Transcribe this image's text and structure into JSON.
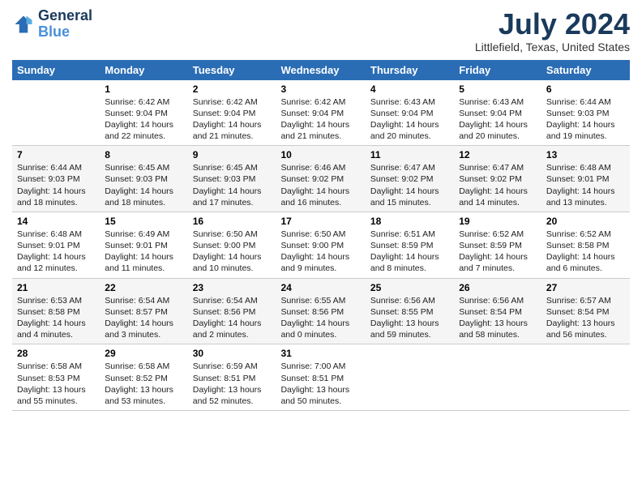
{
  "logo": {
    "line1": "General",
    "line2": "Blue"
  },
  "title": "July 2024",
  "location": "Littlefield, Texas, United States",
  "days_of_week": [
    "Sunday",
    "Monday",
    "Tuesday",
    "Wednesday",
    "Thursday",
    "Friday",
    "Saturday"
  ],
  "weeks": [
    [
      {
        "day": "",
        "info": ""
      },
      {
        "day": "1",
        "info": "Sunrise: 6:42 AM\nSunset: 9:04 PM\nDaylight: 14 hours\nand 22 minutes."
      },
      {
        "day": "2",
        "info": "Sunrise: 6:42 AM\nSunset: 9:04 PM\nDaylight: 14 hours\nand 21 minutes."
      },
      {
        "day": "3",
        "info": "Sunrise: 6:42 AM\nSunset: 9:04 PM\nDaylight: 14 hours\nand 21 minutes."
      },
      {
        "day": "4",
        "info": "Sunrise: 6:43 AM\nSunset: 9:04 PM\nDaylight: 14 hours\nand 20 minutes."
      },
      {
        "day": "5",
        "info": "Sunrise: 6:43 AM\nSunset: 9:04 PM\nDaylight: 14 hours\nand 20 minutes."
      },
      {
        "day": "6",
        "info": "Sunrise: 6:44 AM\nSunset: 9:03 PM\nDaylight: 14 hours\nand 19 minutes."
      }
    ],
    [
      {
        "day": "7",
        "info": "Sunrise: 6:44 AM\nSunset: 9:03 PM\nDaylight: 14 hours\nand 18 minutes."
      },
      {
        "day": "8",
        "info": "Sunrise: 6:45 AM\nSunset: 9:03 PM\nDaylight: 14 hours\nand 18 minutes."
      },
      {
        "day": "9",
        "info": "Sunrise: 6:45 AM\nSunset: 9:03 PM\nDaylight: 14 hours\nand 17 minutes."
      },
      {
        "day": "10",
        "info": "Sunrise: 6:46 AM\nSunset: 9:02 PM\nDaylight: 14 hours\nand 16 minutes."
      },
      {
        "day": "11",
        "info": "Sunrise: 6:47 AM\nSunset: 9:02 PM\nDaylight: 14 hours\nand 15 minutes."
      },
      {
        "day": "12",
        "info": "Sunrise: 6:47 AM\nSunset: 9:02 PM\nDaylight: 14 hours\nand 14 minutes."
      },
      {
        "day": "13",
        "info": "Sunrise: 6:48 AM\nSunset: 9:01 PM\nDaylight: 14 hours\nand 13 minutes."
      }
    ],
    [
      {
        "day": "14",
        "info": "Sunrise: 6:48 AM\nSunset: 9:01 PM\nDaylight: 14 hours\nand 12 minutes."
      },
      {
        "day": "15",
        "info": "Sunrise: 6:49 AM\nSunset: 9:01 PM\nDaylight: 14 hours\nand 11 minutes."
      },
      {
        "day": "16",
        "info": "Sunrise: 6:50 AM\nSunset: 9:00 PM\nDaylight: 14 hours\nand 10 minutes."
      },
      {
        "day": "17",
        "info": "Sunrise: 6:50 AM\nSunset: 9:00 PM\nDaylight: 14 hours\nand 9 minutes."
      },
      {
        "day": "18",
        "info": "Sunrise: 6:51 AM\nSunset: 8:59 PM\nDaylight: 14 hours\nand 8 minutes."
      },
      {
        "day": "19",
        "info": "Sunrise: 6:52 AM\nSunset: 8:59 PM\nDaylight: 14 hours\nand 7 minutes."
      },
      {
        "day": "20",
        "info": "Sunrise: 6:52 AM\nSunset: 8:58 PM\nDaylight: 14 hours\nand 6 minutes."
      }
    ],
    [
      {
        "day": "21",
        "info": "Sunrise: 6:53 AM\nSunset: 8:58 PM\nDaylight: 14 hours\nand 4 minutes."
      },
      {
        "day": "22",
        "info": "Sunrise: 6:54 AM\nSunset: 8:57 PM\nDaylight: 14 hours\nand 3 minutes."
      },
      {
        "day": "23",
        "info": "Sunrise: 6:54 AM\nSunset: 8:56 PM\nDaylight: 14 hours\nand 2 minutes."
      },
      {
        "day": "24",
        "info": "Sunrise: 6:55 AM\nSunset: 8:56 PM\nDaylight: 14 hours\nand 0 minutes."
      },
      {
        "day": "25",
        "info": "Sunrise: 6:56 AM\nSunset: 8:55 PM\nDaylight: 13 hours\nand 59 minutes."
      },
      {
        "day": "26",
        "info": "Sunrise: 6:56 AM\nSunset: 8:54 PM\nDaylight: 13 hours\nand 58 minutes."
      },
      {
        "day": "27",
        "info": "Sunrise: 6:57 AM\nSunset: 8:54 PM\nDaylight: 13 hours\nand 56 minutes."
      }
    ],
    [
      {
        "day": "28",
        "info": "Sunrise: 6:58 AM\nSunset: 8:53 PM\nDaylight: 13 hours\nand 55 minutes."
      },
      {
        "day": "29",
        "info": "Sunrise: 6:58 AM\nSunset: 8:52 PM\nDaylight: 13 hours\nand 53 minutes."
      },
      {
        "day": "30",
        "info": "Sunrise: 6:59 AM\nSunset: 8:51 PM\nDaylight: 13 hours\nand 52 minutes."
      },
      {
        "day": "31",
        "info": "Sunrise: 7:00 AM\nSunset: 8:51 PM\nDaylight: 13 hours\nand 50 minutes."
      },
      {
        "day": "",
        "info": ""
      },
      {
        "day": "",
        "info": ""
      },
      {
        "day": "",
        "info": ""
      }
    ]
  ]
}
